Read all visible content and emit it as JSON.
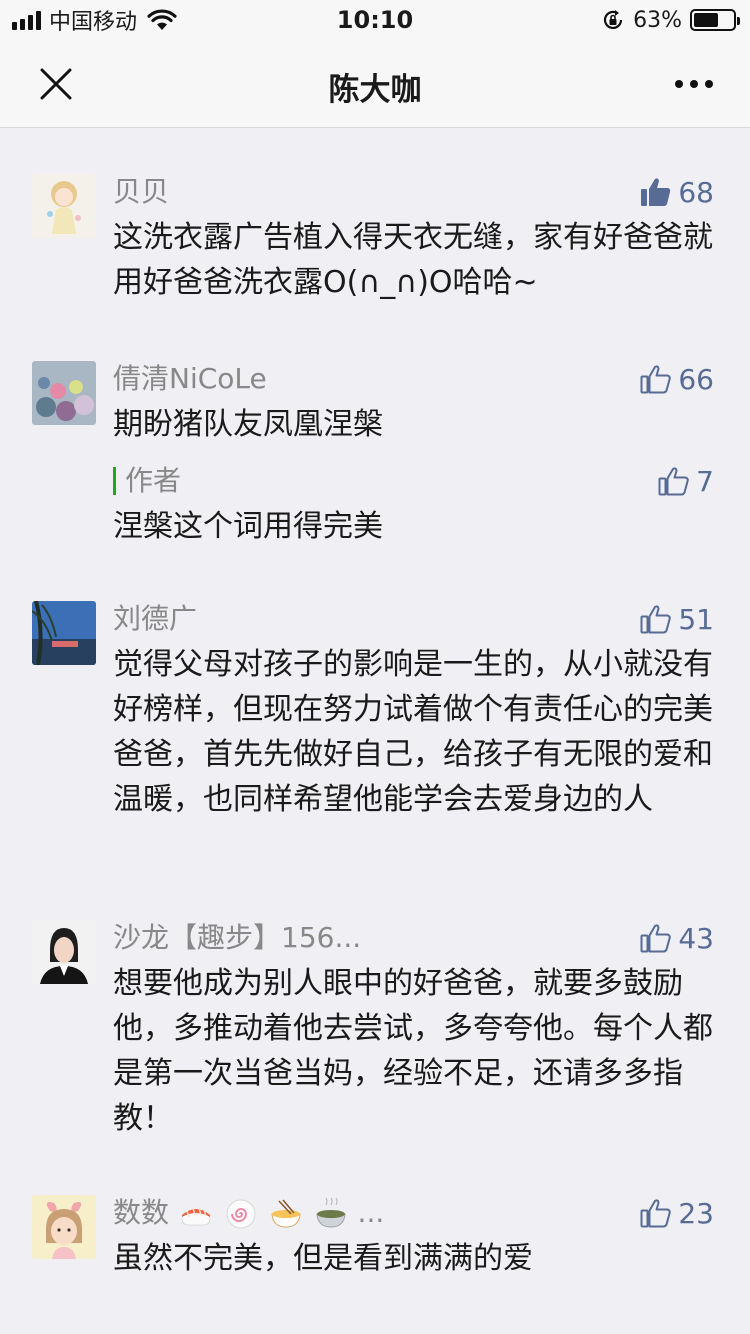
{
  "status_bar": {
    "carrier": "中国移动",
    "time": "10:10",
    "battery_percent": "63%",
    "battery_level": 0.63
  },
  "nav": {
    "title": "陈大咖"
  },
  "comments": [
    {
      "name": "贝贝",
      "likes": "68",
      "liked": true,
      "text": "这洗衣露广告植入得天衣无缝，家有好爸爸就用好爸爸洗衣露O(∩_∩)O哈哈~"
    },
    {
      "name": "倩清NiCoLe",
      "likes": "66",
      "liked": false,
      "text": "期盼猪队友凤凰涅槃",
      "reply": {
        "name": "作者",
        "likes": "7",
        "text": "涅槃这个词用得完美"
      }
    },
    {
      "name": "刘德广",
      "likes": "51",
      "liked": false,
      "text": "觉得父母对孩子的影响是一生的，从小就没有好榜样，但现在努力试着做个有责任心的完美爸爸，首先先做好自己，给孩子有无限的爱和温暖，也同样希望他能学会去爱身边的人"
    },
    {
      "name": "沙龙【趣步】156...",
      "likes": "43",
      "liked": false,
      "text": "想要他成为别人眼中的好爸爸，就要多鼓励他，多推动着他去尝试，多夸夸他。每个人都是第一次当爸当妈，经验不足，还请多多指教！"
    },
    {
      "name": "数数",
      "name_suffix": "...",
      "name_emojis": [
        "sushi-emoji",
        "fish-cake-emoji",
        "noodles-emoji",
        "bowl-emoji"
      ],
      "likes": "23",
      "liked": false,
      "text": "虽然不完美，但是看到满满的爱"
    }
  ],
  "colors": {
    "background": "#efeff4",
    "link_blue": "#576b95",
    "author_green": "#1aad19",
    "meta_gray": "#888888"
  }
}
